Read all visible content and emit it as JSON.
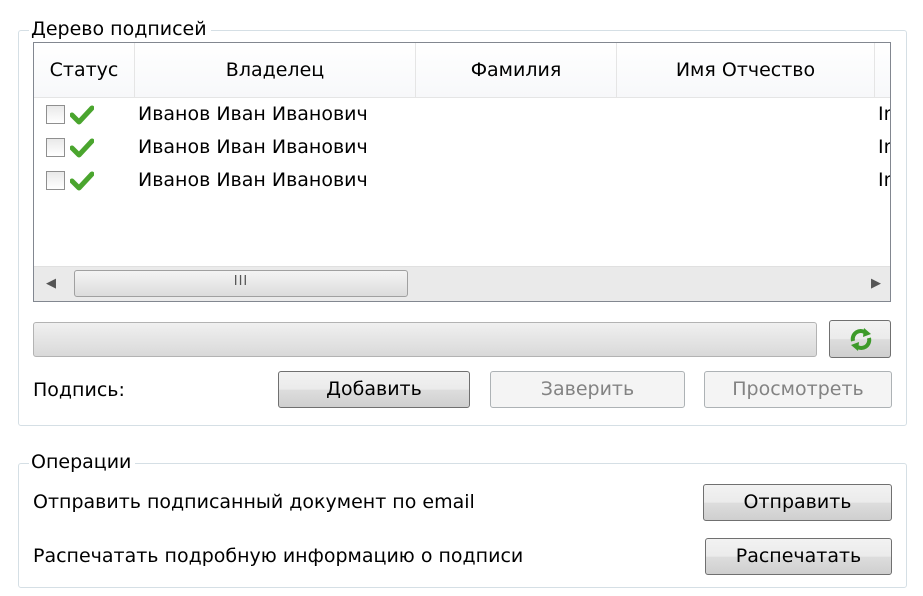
{
  "signatures_group": {
    "title": "Дерево подписей",
    "columns": [
      "Статус",
      "Владелец",
      "Фамилия",
      "Имя Отчество"
    ],
    "rows": [
      {
        "owner": "Иванов Иван Иванович",
        "truncated": "In",
        "checked": false,
        "status_icon": "green-check-icon"
      },
      {
        "owner": "Иванов Иван Иванович",
        "truncated": "In",
        "checked": false,
        "status_icon": "green-check-icon"
      },
      {
        "owner": "Иванов Иван Иванович",
        "truncated": "In",
        "checked": false,
        "status_icon": "green-check-icon"
      }
    ],
    "scroll_thumb_grip": "III",
    "progress": 0,
    "refresh_icon": "refresh-icon",
    "signature_label": "Подпись:",
    "add_button": "Добавить",
    "certify_button": "Заверить",
    "view_button": "Просмотреть"
  },
  "operations_group": {
    "title": "Операции",
    "send_text": "Отправить подписанный документ по email",
    "send_button": "Отправить",
    "print_text": "Распечатать подробную информацию о подписи",
    "print_button": "Распечатать"
  },
  "colors": {
    "check_green": "#4aa52e",
    "group_border": "#d5dfe5",
    "disabled_text": "#838383"
  }
}
